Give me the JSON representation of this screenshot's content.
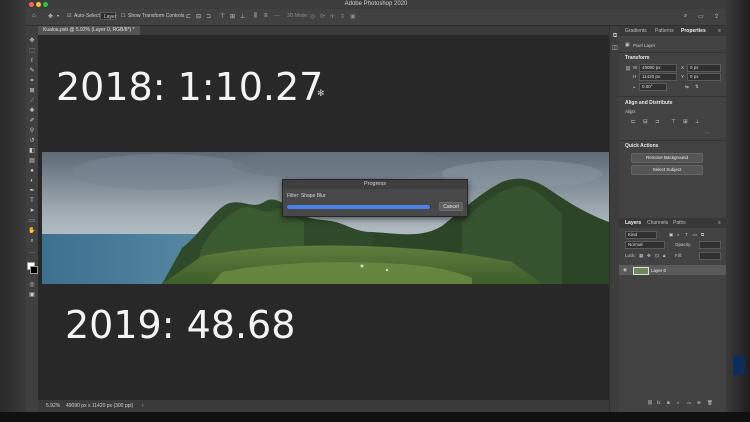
{
  "window": {
    "title": "Adobe Photoshop 2020"
  },
  "options_bar": {
    "auto_select_label": "Auto-Select:",
    "auto_select_value": "Layer",
    "show_transform_label": "Show Transform Controls",
    "mode_3d_label": "3D Mode:"
  },
  "document_tab": {
    "label": "Kualoa.psb @ 5.92% (Layer 0, RGB/8*) *"
  },
  "canvas": {
    "text_top": "2018: 1:10.27",
    "text_bottom": "2019: 48.68"
  },
  "progress_dialog": {
    "title": "Progress",
    "label": "Filter: Shape Blur",
    "progress": 0.99,
    "cancel_label": "Cancel"
  },
  "status_bar": {
    "zoom": "5.92%",
    "doc_size": "49090 px x 11420 px (300 ppi)"
  },
  "top_panels": {
    "tabs": [
      "Gradients",
      "Patterns",
      "Properties"
    ],
    "active_tab": "Properties",
    "layer_kind": "Pixel Layer",
    "transform_header": "Transform",
    "w_label": "W",
    "w_value": "49090 px",
    "h_label": "H",
    "h_value": "11420 px",
    "x_label": "X",
    "x_value": "0 px",
    "y_label": "Y",
    "y_value": "0 px",
    "angle_value": "0.00°",
    "align_header": "Align and Distribute",
    "align_label": "Align:",
    "quick_actions_header": "Quick Actions",
    "remove_bg_label": "Remove Background",
    "select_subject_label": "Select Subject"
  },
  "layers_panel": {
    "tabs": [
      "Layers",
      "Channels",
      "Paths"
    ],
    "active_tab": "Layers",
    "kind_label": "Kind",
    "blend_mode": "Normal",
    "opacity_label": "Opacity:",
    "lock_label": "Lock:",
    "fill_label": "Fill:",
    "layer_name": "Layer 0"
  },
  "colors": {
    "accent_blue": "#4a82e8",
    "canvas_bg": "#282828",
    "panel_bg": "#424242"
  }
}
